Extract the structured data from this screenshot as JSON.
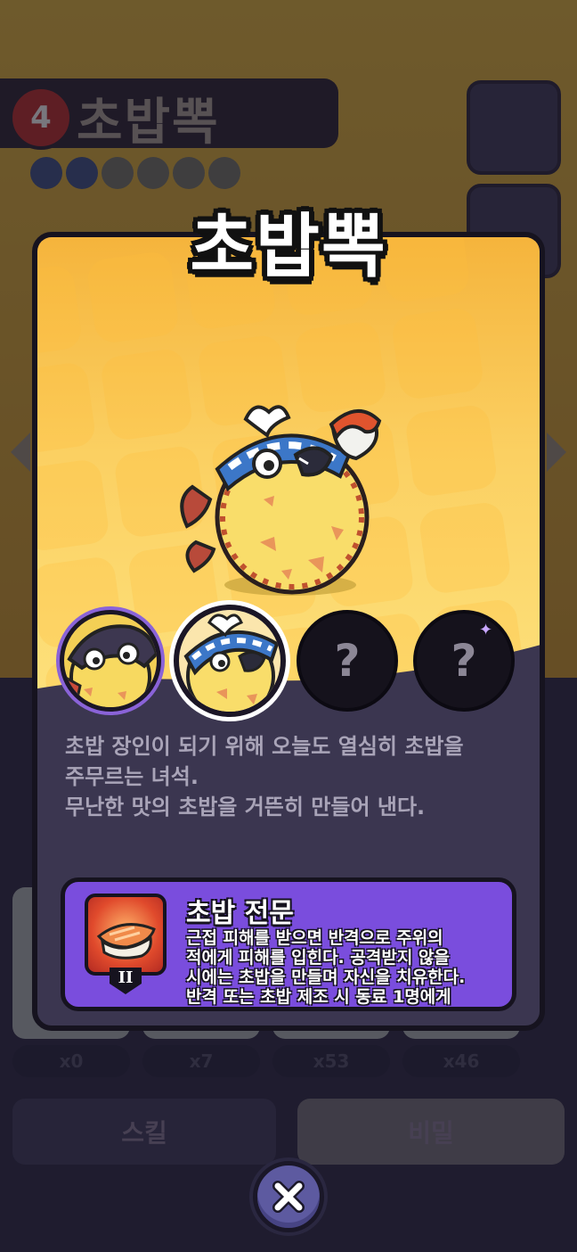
{
  "background": {
    "level": "4",
    "name": "초밥뽁",
    "counts": [
      "x0",
      "x7",
      "x53",
      "x46"
    ],
    "buttons": {
      "skill": "스킬",
      "detail": "비밀"
    }
  },
  "popup": {
    "title": "초밥뽁",
    "description": [
      "초밥 장인이 되기 위해 오늘도 열심히 초밥을",
      "주무르는 녀석.",
      "무난한 맛의 초밥을 거뜬히 만들어 낸다."
    ],
    "variants": [
      {
        "state": "unlocked",
        "label": ""
      },
      {
        "state": "selected",
        "label": ""
      },
      {
        "state": "locked",
        "label": "?"
      },
      {
        "state": "locked",
        "label": "?"
      }
    ],
    "skill": {
      "title": "초밥 전문",
      "rank": "II",
      "text": [
        "근접 피해를 받으면 반격으로 주위의",
        "적에게 피해를 입힌다. 공격받지 않을",
        "시에는 초밥을 만들며 자신을 치유한다.",
        "반격 또는 초밥 제조 시 동료 1명에게"
      ]
    }
  },
  "colors": {
    "art_top": "#f5b43c",
    "art_bottom": "#fde07a",
    "panel": "#3b3650",
    "skill_bg": "#7a4ddd",
    "close_button": "#5d5aa0"
  },
  "icons": {
    "close": "close-icon",
    "lock": "question-mark"
  }
}
